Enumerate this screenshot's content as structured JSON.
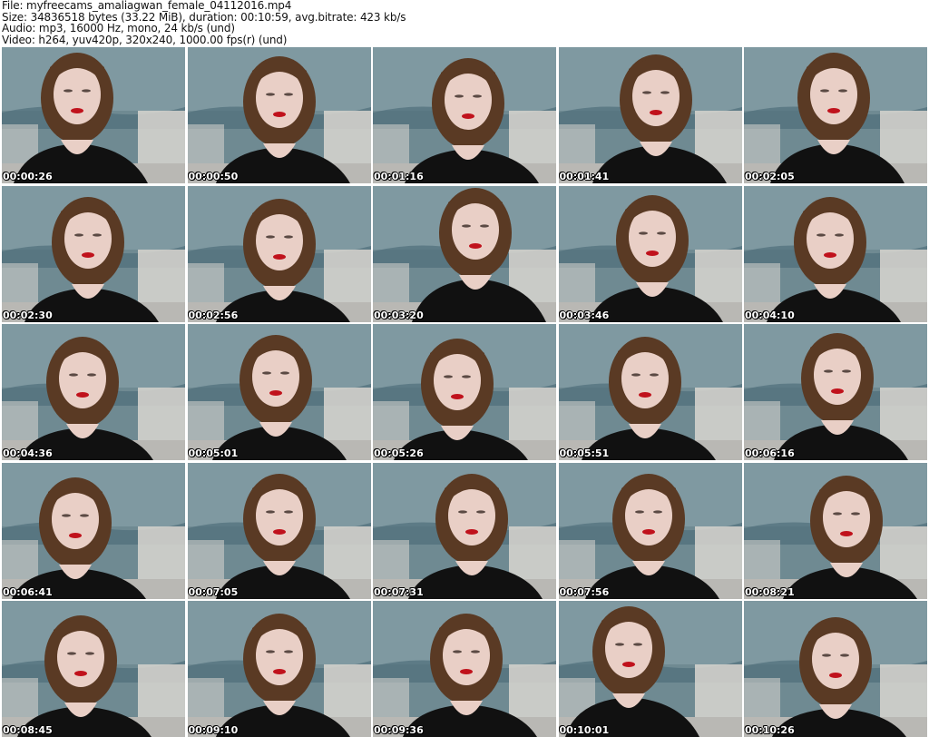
{
  "header": {
    "file_line": "File: myfreecams_amaliagwan_female_04112016.mp4",
    "size_line": "Size: 34836518 bytes (33.22 MiB), duration: 00:10:59, avg.bitrate: 423 kb/s",
    "audio_line": "Audio: mp3, 16000 Hz, mono, 24 kb/s (und)",
    "video_line": "Video: h264, yuv420p, 320x240, 1000.00 fps(r) (und)"
  },
  "frames": [
    {
      "timestamp": "00:00:26"
    },
    {
      "timestamp": "00:00:50"
    },
    {
      "timestamp": "00:01:16"
    },
    {
      "timestamp": "00:01:41"
    },
    {
      "timestamp": "00:02:05"
    },
    {
      "timestamp": "00:02:30"
    },
    {
      "timestamp": "00:02:56"
    },
    {
      "timestamp": "00:03:20"
    },
    {
      "timestamp": "00:03:46"
    },
    {
      "timestamp": "00:04:10"
    },
    {
      "timestamp": "00:04:36"
    },
    {
      "timestamp": "00:05:01"
    },
    {
      "timestamp": "00:05:26"
    },
    {
      "timestamp": "00:05:51"
    },
    {
      "timestamp": "00:06:16"
    },
    {
      "timestamp": "00:06:41"
    },
    {
      "timestamp": "00:07:05"
    },
    {
      "timestamp": "00:07:31"
    },
    {
      "timestamp": "00:07:56"
    },
    {
      "timestamp": "00:08:21"
    },
    {
      "timestamp": "00:08:45"
    },
    {
      "timestamp": "00:09:10"
    },
    {
      "timestamp": "00:09:36"
    },
    {
      "timestamp": "00:10:01"
    },
    {
      "timestamp": "00:10:26"
    }
  ],
  "colors": {
    "background": "#ffffff",
    "wall": "#6f8a92",
    "hair": "#5a3a24",
    "skin": "#e9cfc6",
    "clothing": "#111111",
    "lips": "#c0121c",
    "sofa": "#d9d6d0"
  }
}
